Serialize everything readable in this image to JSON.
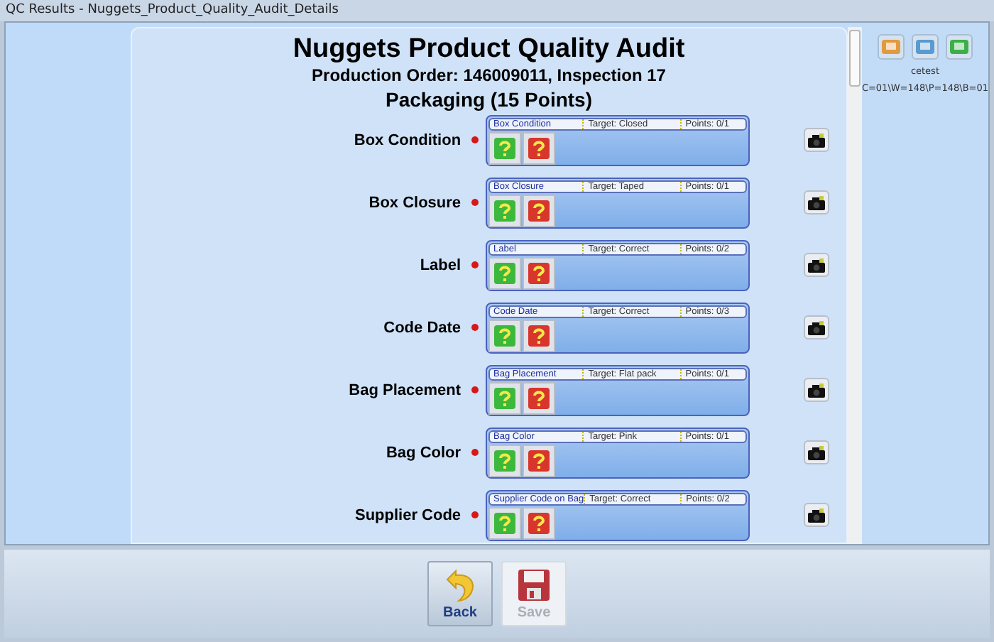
{
  "window": {
    "title": "QC Results - Nuggets_Product_Quality_Audit_Details"
  },
  "header": {
    "title": "Nuggets Product Quality Audit",
    "subtitle": "Production Order: 146009011, Inspection 17",
    "section": "Packaging (15 Points)"
  },
  "items": [
    {
      "label": "Box Condition",
      "name": "Box Condition",
      "target": "Target:  Closed",
      "points": "Points: 0/1"
    },
    {
      "label": "Box Closure",
      "name": "Box Closure",
      "target": "Target:  Taped",
      "points": "Points: 0/1"
    },
    {
      "label": "Label",
      "name": "Label",
      "target": "Target:  Correct",
      "points": "Points: 0/2"
    },
    {
      "label": "Code Date",
      "name": "Code Date",
      "target": "Target:  Correct",
      "points": "Points: 0/3"
    },
    {
      "label": "Bag Placement",
      "name": "Bag Placement",
      "target": "Target:  Flat pack",
      "points": "Points: 0/1"
    },
    {
      "label": "Bag Color",
      "name": "Bag Color",
      "target": "Target:  Pink",
      "points": "Points: 0/1"
    },
    {
      "label": "Supplier Code",
      "name": "Supplier Code on Bag",
      "target": "Target:  Correct",
      "points": "Points: 0/2"
    }
  ],
  "user": {
    "name": "cetest",
    "code": "C=01\\W=148\\P=148\\B=01"
  },
  "buttons": [
    {
      "kind": "back",
      "label": "Back",
      "disabled": false
    },
    {
      "kind": "save",
      "label": "Save",
      "disabled": true
    }
  ]
}
